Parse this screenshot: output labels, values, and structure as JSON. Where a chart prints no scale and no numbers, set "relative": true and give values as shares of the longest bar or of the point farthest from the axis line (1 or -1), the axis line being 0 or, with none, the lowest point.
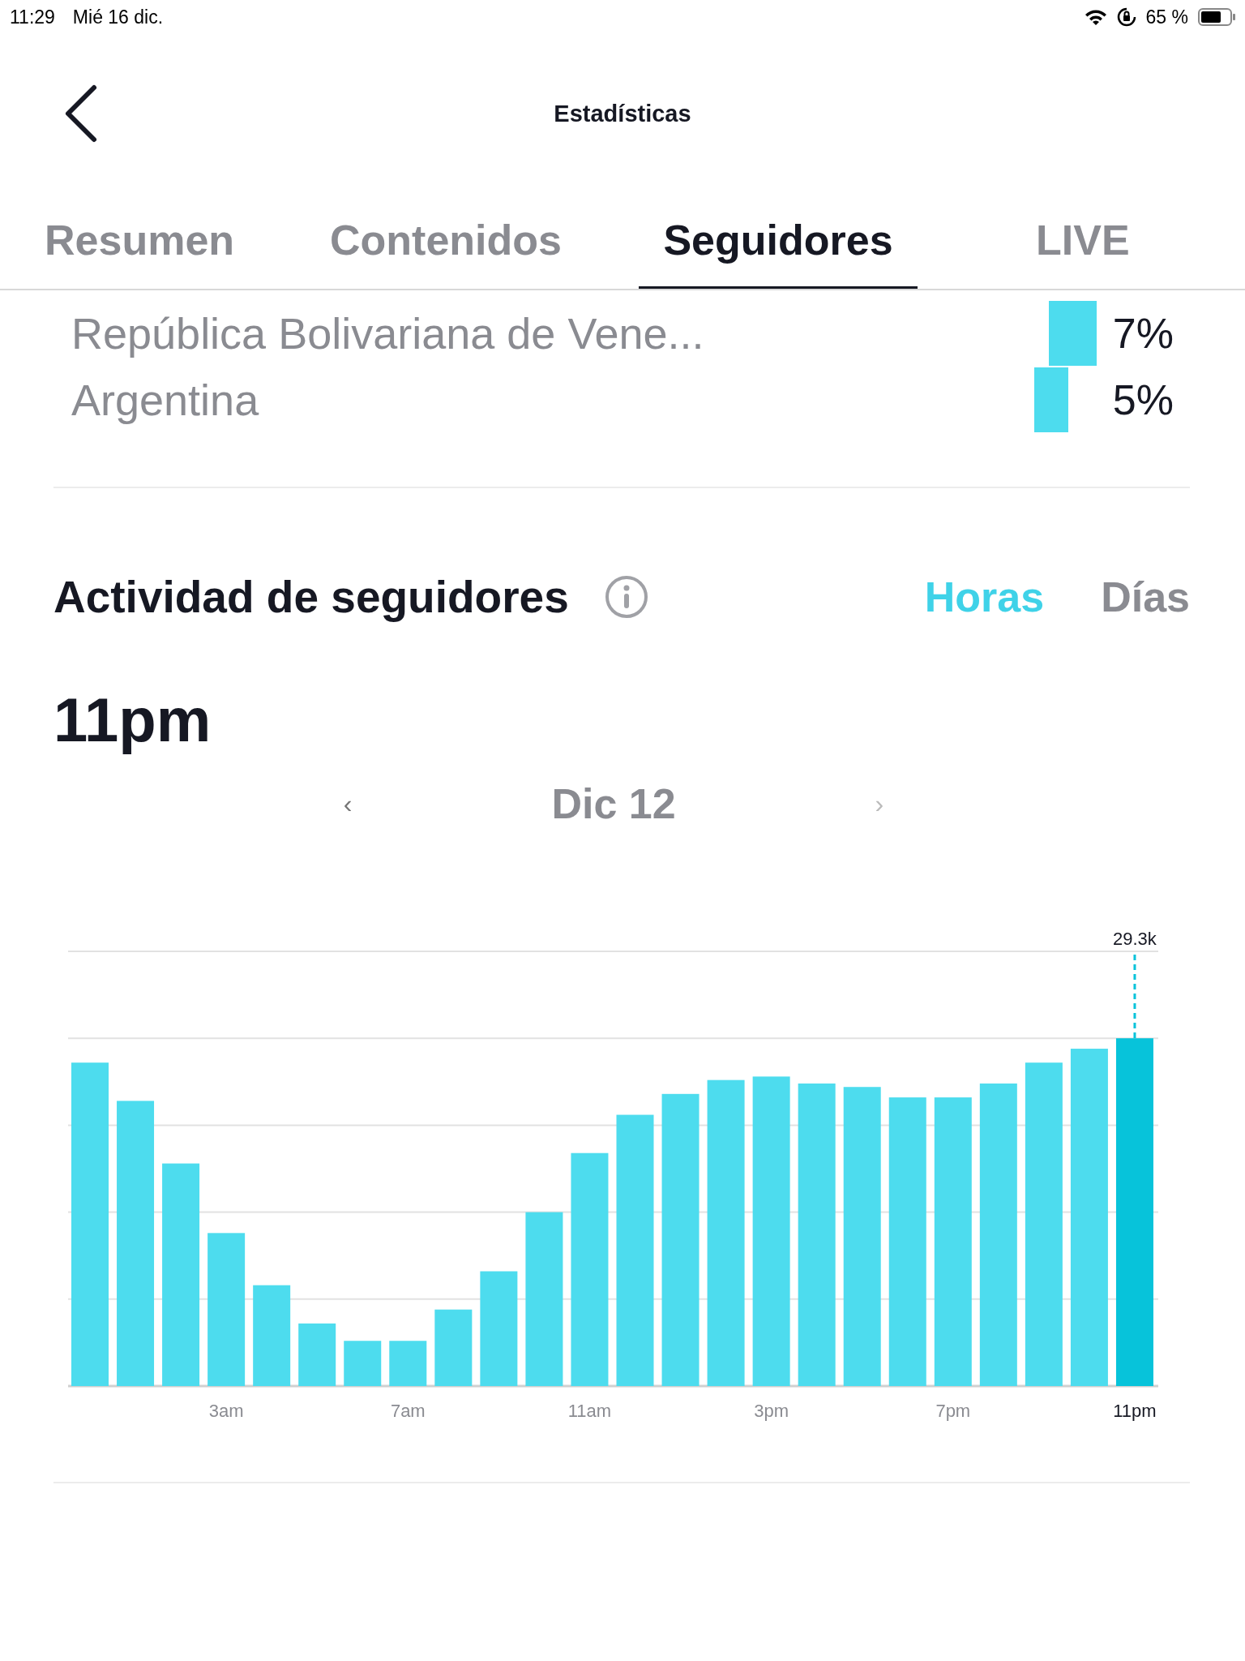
{
  "status_bar": {
    "time": "11:29",
    "date": "Mié 16 dic.",
    "battery": "65 %"
  },
  "header": {
    "title": "Estadísticas"
  },
  "tabs": [
    {
      "label": "Resumen",
      "selected": false
    },
    {
      "label": "Contenidos",
      "selected": false
    },
    {
      "label": "Seguidores",
      "selected": true
    },
    {
      "label": "LIVE",
      "selected": false
    }
  ],
  "countries": [
    {
      "name": "República Bolivariana de Vene...",
      "percent": "7%"
    },
    {
      "name": "Argentina",
      "percent": "5%"
    }
  ],
  "activity": {
    "title": "Actividad de seguidores",
    "modes": [
      {
        "label": "Horas",
        "selected": true
      },
      {
        "label": "Días",
        "selected": false
      }
    ],
    "selected_hour": "11pm",
    "date": "Dic 12",
    "prev": "‹",
    "next": "›",
    "chart_data": {
      "type": "bar",
      "relative": true,
      "categories": [
        null,
        null,
        null,
        "3am",
        null,
        null,
        null,
        "7am",
        null,
        null,
        null,
        "11am",
        null,
        null,
        null,
        "3pm",
        null,
        null,
        null,
        "7pm",
        null,
        null,
        null,
        "11pm"
      ],
      "series": [
        {
          "color": "#4ddcee",
          "values": [
            0.93,
            0.82,
            0.64,
            0.44,
            0.29,
            0.18,
            0.13,
            0.13,
            0.22,
            0.33,
            0.5,
            0.67,
            0.78,
            0.84,
            0.88,
            0.89,
            0.87,
            0.86,
            0.83,
            0.83,
            0.87,
            0.93,
            0.97,
            1
          ]
        }
      ],
      "annotations": [
        {
          "x": "11pm",
          "text": "29.3k"
        }
      ]
    }
  }
}
